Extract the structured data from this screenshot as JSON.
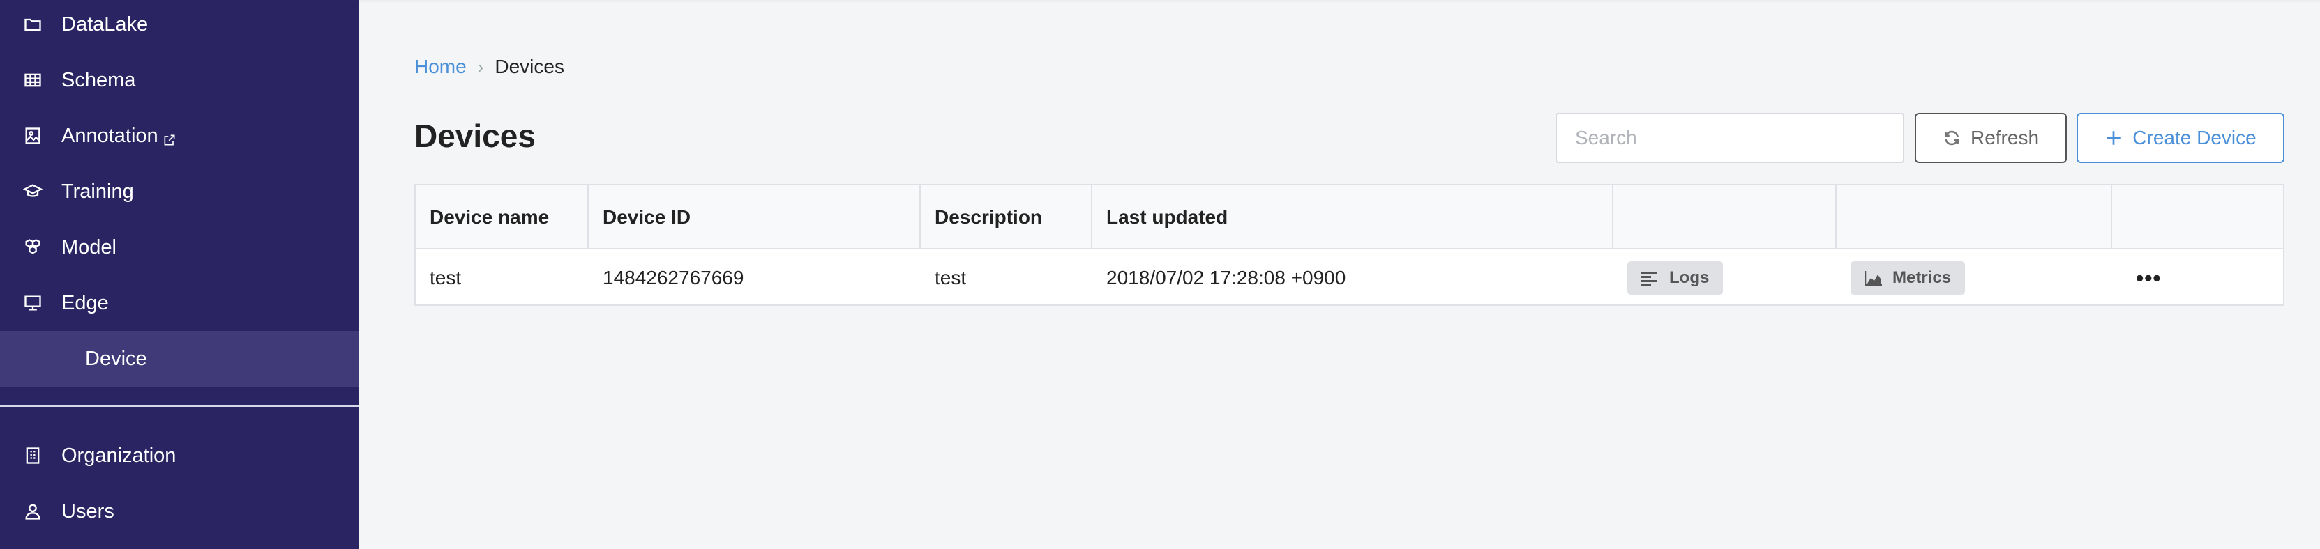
{
  "sidebar": {
    "items": [
      {
        "label": "DataLake",
        "icon": "folder-icon"
      },
      {
        "label": "Schema",
        "icon": "table-icon"
      },
      {
        "label": "Annotation",
        "icon": "image-icon",
        "external": true
      },
      {
        "label": "Training",
        "icon": "graduation-cap-icon"
      },
      {
        "label": "Model",
        "icon": "cubes-icon"
      },
      {
        "label": "Edge",
        "icon": "monitor-icon"
      }
    ],
    "sub_item": {
      "label": "Device"
    },
    "bottom_items": [
      {
        "label": "Organization",
        "icon": "building-icon"
      },
      {
        "label": "Users",
        "icon": "user-icon"
      }
    ]
  },
  "breadcrumb": {
    "home": "Home",
    "separator": "›",
    "current": "Devices"
  },
  "page": {
    "title": "Devices"
  },
  "search": {
    "placeholder": "Search",
    "value": ""
  },
  "buttons": {
    "refresh": "Refresh",
    "create": "Create Device"
  },
  "table": {
    "headers": [
      "Device name",
      "Device ID",
      "Description",
      "Last updated",
      "",
      "",
      ""
    ],
    "rows": [
      {
        "name": "test",
        "device_id": "1484262767669",
        "description": "test",
        "last_updated": "2018/07/02 17:28:08 +0900",
        "logs_label": "Logs",
        "metrics_label": "Metrics",
        "more": "•••"
      }
    ]
  },
  "colors": {
    "sidebar_bg": "#2a2462",
    "sidebar_active": "#403b78",
    "accent": "#4a90d9",
    "page_bg": "#f4f5f7"
  }
}
